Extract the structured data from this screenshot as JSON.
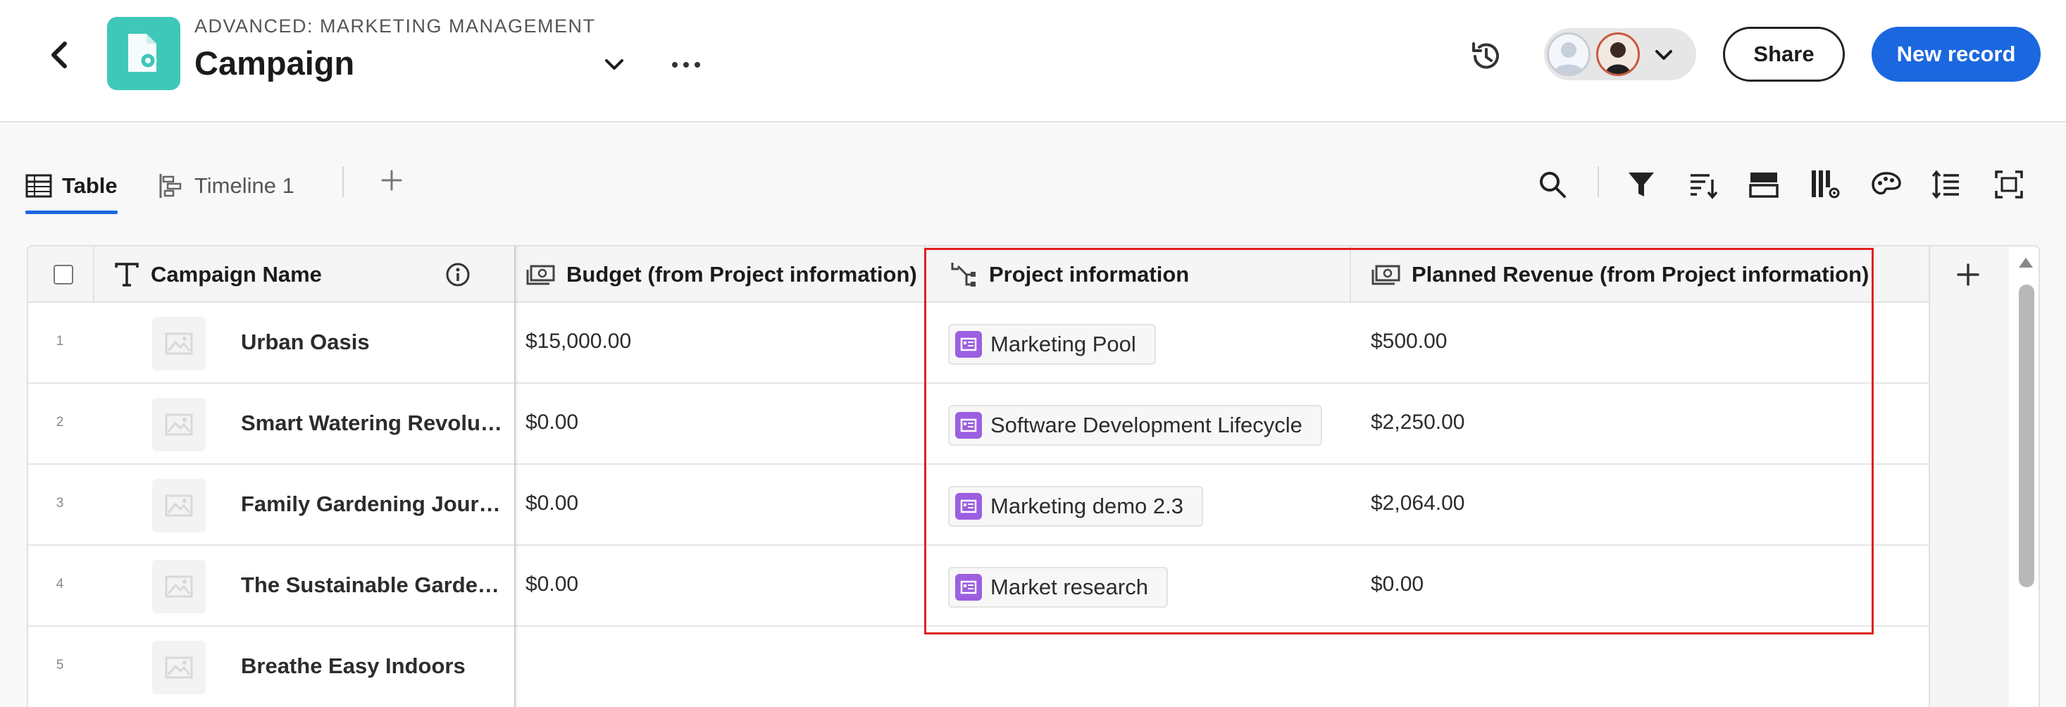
{
  "header": {
    "workspace": "ADVANCED: MARKETING MANAGEMENT",
    "title": "Campaign",
    "share_label": "Share",
    "new_record_label": "New record"
  },
  "views": {
    "tabs": [
      {
        "label": "Table",
        "icon": "table-icon",
        "active": true
      },
      {
        "label": "Timeline 1",
        "icon": "timeline-icon",
        "active": false
      }
    ]
  },
  "toolbar": {
    "icons": [
      "search-icon",
      "filter-icon",
      "sort-icon",
      "group-icon",
      "fields-icon",
      "color-icon",
      "row-height-icon",
      "fullscreen-icon"
    ]
  },
  "table": {
    "columns": [
      {
        "label": "Campaign Name",
        "icon": "text-type-icon"
      },
      {
        "label": "Budget (from Project information)",
        "icon": "currency-icon"
      },
      {
        "label": "Project information",
        "icon": "connection-icon"
      },
      {
        "label": "Planned Revenue (from Project information)",
        "icon": "currency-icon"
      }
    ],
    "rows": [
      {
        "num": "1",
        "name": "Urban Oasis",
        "budget": "$15,000.00",
        "project": "Marketing Pool",
        "revenue": "$500.00"
      },
      {
        "num": "2",
        "name": "Smart Watering Revolu…",
        "budget": "$0.00",
        "project": "Software Development Lifecycle",
        "revenue": "$2,250.00"
      },
      {
        "num": "3",
        "name": "Family Gardening Jour…",
        "budget": "$0.00",
        "project": "Marketing demo 2.3",
        "revenue": "$2,064.00"
      },
      {
        "num": "4",
        "name": "The Sustainable Garde…",
        "budget": "$0.00",
        "project": "Market research",
        "revenue": "$0.00"
      },
      {
        "num": "5",
        "name": "Breathe Easy Indoors",
        "budget": "",
        "project": "",
        "revenue": ""
      }
    ]
  },
  "colors": {
    "primary": "#1a67e0",
    "app_icon": "#3fc8b8",
    "record_chip": "#9b5fe0",
    "highlight": "#e02020"
  }
}
